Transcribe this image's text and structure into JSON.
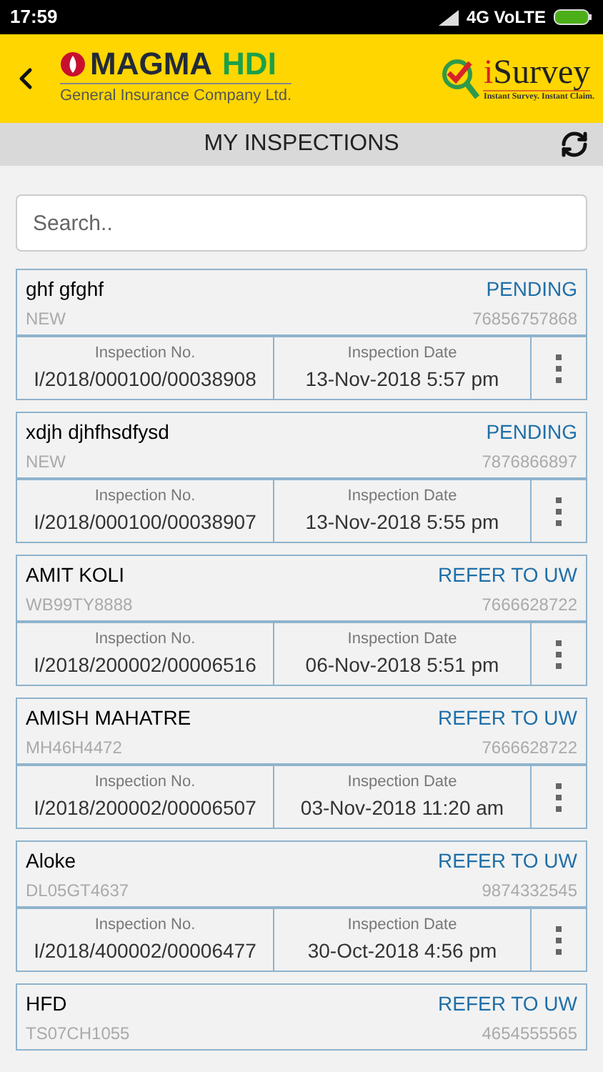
{
  "status_bar": {
    "time": "17:59",
    "network": "4G VoLTE"
  },
  "header": {
    "brand": {
      "name": "MAGMA",
      "suffix": "HDI",
      "tagline": "General Insurance Company Ltd."
    },
    "app": {
      "name_prefix": "i",
      "name": "Survey",
      "tagline": "Instant Survey. Instant Claim."
    }
  },
  "title_bar": {
    "title": "MY INSPECTIONS"
  },
  "search": {
    "placeholder": "Search.."
  },
  "inspections": [
    {
      "name": "ghf gfghf",
      "status": "PENDING",
      "registration": "NEW",
      "phone": "76856757868",
      "number_label": "Inspection No.",
      "number": "I/2018/000100/00038908",
      "date_label": "Inspection Date",
      "date": "13-Nov-2018 5:57 pm"
    },
    {
      "name": "xdjh djhfhsdfysd",
      "status": "PENDING",
      "registration": "NEW",
      "phone": "7876866897",
      "number_label": "Inspection No.",
      "number": "I/2018/000100/00038907",
      "date_label": "Inspection Date",
      "date": "13-Nov-2018 5:55 pm"
    },
    {
      "name": "AMIT KOLI",
      "status": "REFER TO UW",
      "registration": "WB99TY8888",
      "phone": "7666628722",
      "number_label": "Inspection No.",
      "number": "I/2018/200002/00006516",
      "date_label": "Inspection Date",
      "date": "06-Nov-2018 5:51 pm"
    },
    {
      "name": "AMISH MAHATRE",
      "status": "REFER TO UW",
      "registration": "MH46H4472",
      "phone": "7666628722",
      "number_label": "Inspection No.",
      "number": "I/2018/200002/00006507",
      "date_label": "Inspection Date",
      "date": "03-Nov-2018 11:20 am"
    },
    {
      "name": "Aloke",
      "status": "REFER TO UW",
      "registration": "DL05GT4637",
      "phone": "9874332545",
      "number_label": "Inspection No.",
      "number": "I/2018/400002/00006477",
      "date_label": "Inspection Date",
      "date": "30-Oct-2018 4:56 pm"
    },
    {
      "name": "HFD",
      "status": "REFER TO UW",
      "registration": "TS07CH1055",
      "phone": "4654555565"
    }
  ]
}
